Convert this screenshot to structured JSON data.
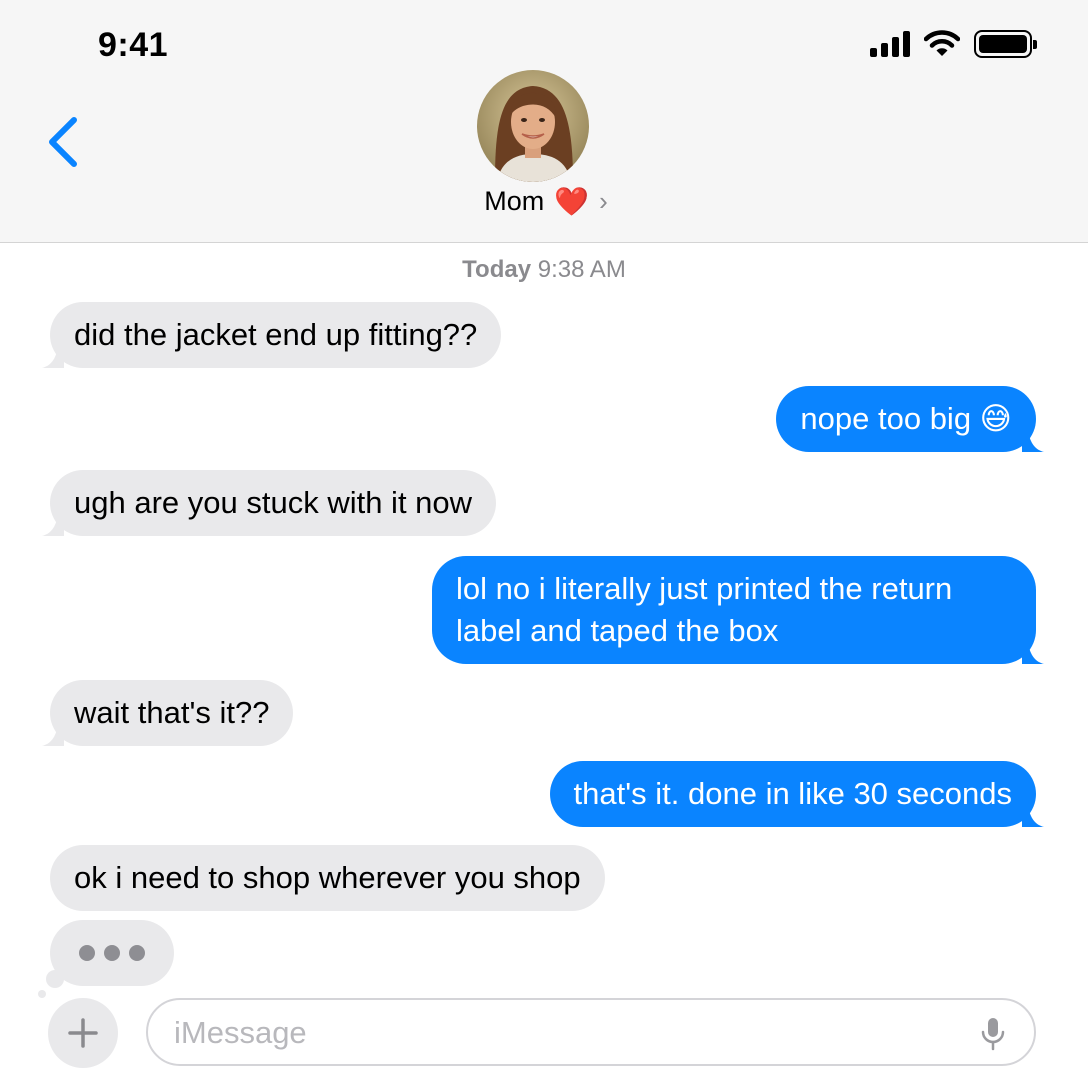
{
  "status_bar": {
    "time": "9:41"
  },
  "header": {
    "contact_name": "Mom",
    "contact_emoji": "❤️",
    "chevron": "›"
  },
  "conversation": {
    "timestamp_day": "Today",
    "timestamp_time": "9:38 AM",
    "messages": [
      {
        "from": "them",
        "text": "did the jacket end up fitting??"
      },
      {
        "from": "me",
        "text": "nope too big 😅"
      },
      {
        "from": "them",
        "text": "ugh are you stuck with it now"
      },
      {
        "from": "me",
        "text": "lol no i literally just printed the return label and taped the box"
      },
      {
        "from": "them",
        "text": "wait that's it??"
      },
      {
        "from": "me",
        "text": "that's it. done in like 30 seconds"
      },
      {
        "from": "them",
        "text": "ok i need to shop wherever you shop"
      }
    ]
  },
  "composer": {
    "placeholder": "iMessage",
    "value": "",
    "icons": [
      "plus-icon",
      "microphone-icon"
    ]
  },
  "colors": {
    "sent_bubble": "#0a84ff",
    "received_bubble": "#e9e9eb",
    "accent": "#0a84ff"
  }
}
